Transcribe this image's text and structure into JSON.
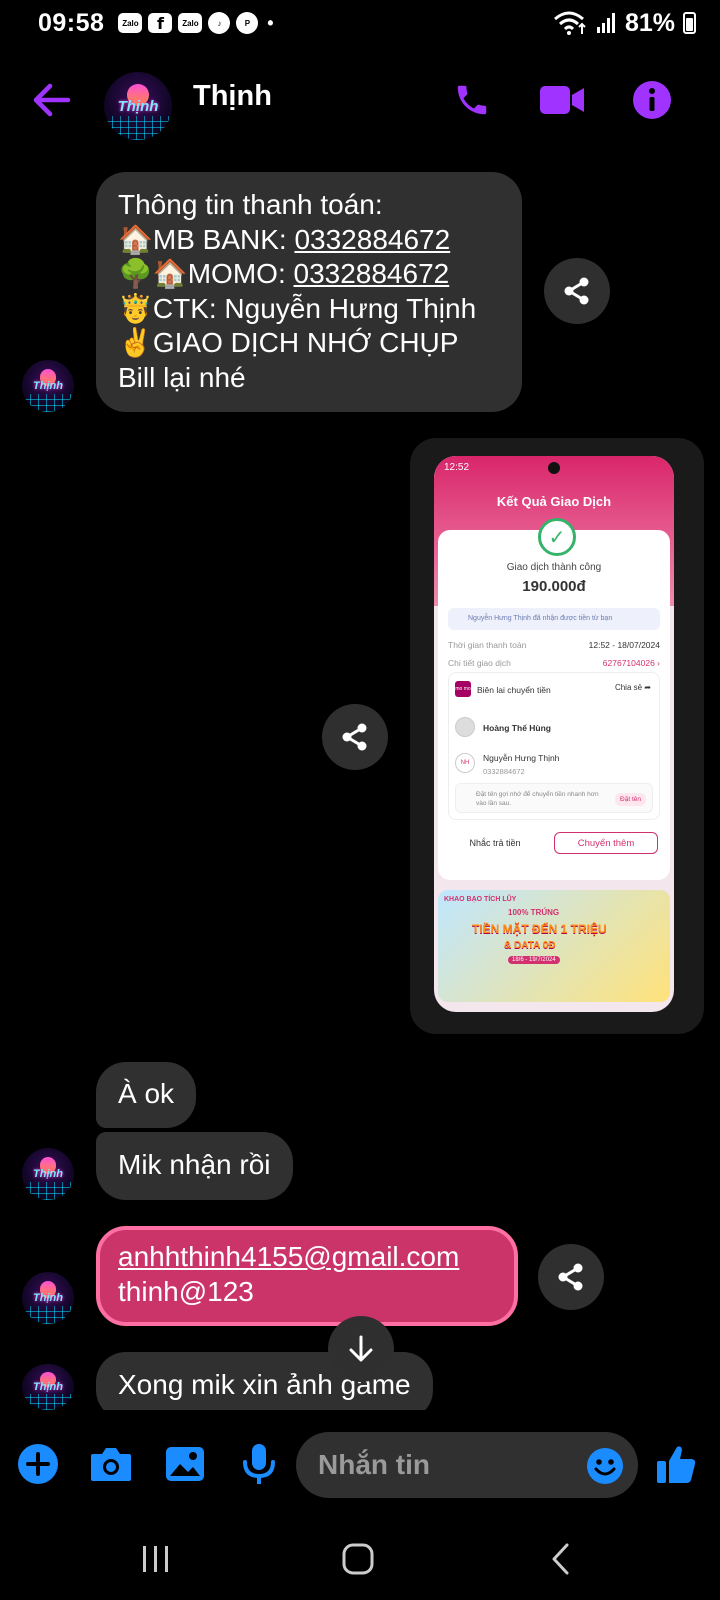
{
  "status_bar": {
    "time": "09:58",
    "notifications": [
      "Zalo",
      "f",
      "Zalo",
      "tiktok",
      "pinterest",
      "•"
    ],
    "battery": "81%"
  },
  "header": {
    "contact_name": "Thịnh",
    "avatar_text": "Thịnh"
  },
  "messages": {
    "payment_info": {
      "line1": "Thông tin thanh toán:",
      "line2_emoji": "🏠",
      "line2_label": "MB BANK: ",
      "line2_value": "0332884672",
      "line3_emoji": "🌳🏠",
      "line3_label": "MOMO: ",
      "line3_value": "0332884672",
      "line4_emoji": "🤴",
      "line4_text": "CTK: Nguyễn Hưng Thịnh",
      "line5_emoji": "✌️",
      "line5_text": "GIAO DỊCH NHỚ CHỤP Bill lại nhé"
    },
    "screenshot": {
      "time": "12:52",
      "title": "Kết Quả Giao Dịch",
      "status": "Giao dịch thành công",
      "amount": "190.000đ",
      "note": "Nguyễn Hưng Thịnh đã nhận được tiền từ bạn",
      "row1_label": "Thời gian thanh toán",
      "row1_value": "12:52 - 18/07/2024",
      "row2_label": "Chi tiết giao dịch",
      "row2_value": "62767104026 ›",
      "receipt_logo": "mo mo",
      "receipt_title": "Biên lai chuyển tiền",
      "receipt_share": "Chia sẻ ➦",
      "sender_name": "Hoàng Thế Hùng",
      "receiver_initials": "NH",
      "receiver_name": "Nguyễn Hưng Thịnh",
      "receiver_phone": "0332884672",
      "hint": "Đặt tên gợi nhớ để chuyển tiền nhanh hơn vào lần sau.",
      "hint_button": "Đặt tên",
      "button_remind": "Nhắc trả tiền",
      "button_more": "Chuyển thêm",
      "banner_tag": "KHAO BẠO TÍCH LŨY",
      "banner_line1": "100% TRÚNG",
      "banner_line2": "TIỀN MẶT ĐẾN 1 TRIỆU",
      "banner_line3": "& DATA 0Đ",
      "banner_line4": "18/6 - 19/7/2024"
    },
    "ok": "À ok",
    "received": "Mik nhận rồi",
    "email": "anhhthinh4155@gmail.com",
    "password": "thinh@123",
    "last": "Xong mik xin ảnh game"
  },
  "composer": {
    "placeholder": "Nhắn tin"
  },
  "colors": {
    "accent": "#a033ff",
    "messenger_blue": "#1a8cff",
    "sent_bubble": "#cb3468",
    "received_bubble": "#303030"
  }
}
